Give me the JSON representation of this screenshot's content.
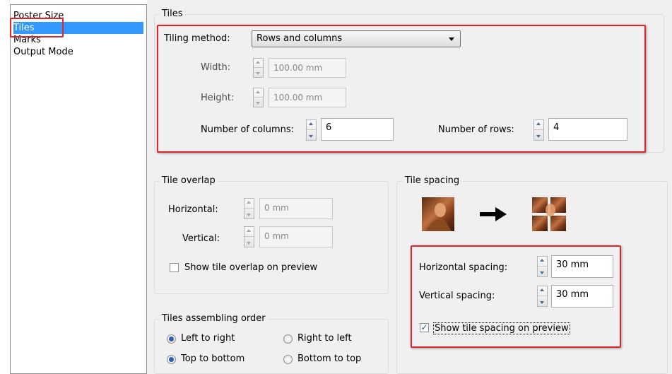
{
  "nav": {
    "items": [
      "Poster Size",
      "Tiles",
      "Marks",
      "Output Mode"
    ],
    "selected": "Tiles"
  },
  "tiles": {
    "group_label": "Tiles",
    "method_label": "Tiling method:",
    "method_value": "Rows and columns",
    "width_label": "Width:",
    "width_value": "100.00 mm",
    "height_label": "Height:",
    "height_value": "100.00 mm",
    "columns_label": "Number of columns:",
    "columns_value": "6",
    "rows_label": "Number of rows:",
    "rows_value": "4"
  },
  "overlap": {
    "group_label": "Tile overlap",
    "horizontal_label": "Horizontal:",
    "horizontal_value": "0 mm",
    "vertical_label": "Vertical:",
    "vertical_value": "0 mm",
    "show_label": "Show tile overlap on preview",
    "show_checked": false
  },
  "spacing": {
    "group_label": "Tile spacing",
    "horizontal_label": "Horizontal spacing:",
    "horizontal_value": "30 mm",
    "vertical_label": "Vertical spacing:",
    "vertical_value": "30 mm",
    "show_label": "Show tile spacing on preview",
    "show_checked": true
  },
  "order": {
    "group_label": "Tiles assembling order",
    "left_to_right": "Left to right",
    "right_to_left": "Right to left",
    "top_to_bottom": "Top to bottom",
    "bottom_to_top": "Bottom to top",
    "horizontal_selected": "Left to right",
    "vertical_selected": "Top to bottom"
  },
  "colors": {
    "selection": "#3399ff",
    "highlight": "#e0262d",
    "panel": "#f0f0f0"
  }
}
